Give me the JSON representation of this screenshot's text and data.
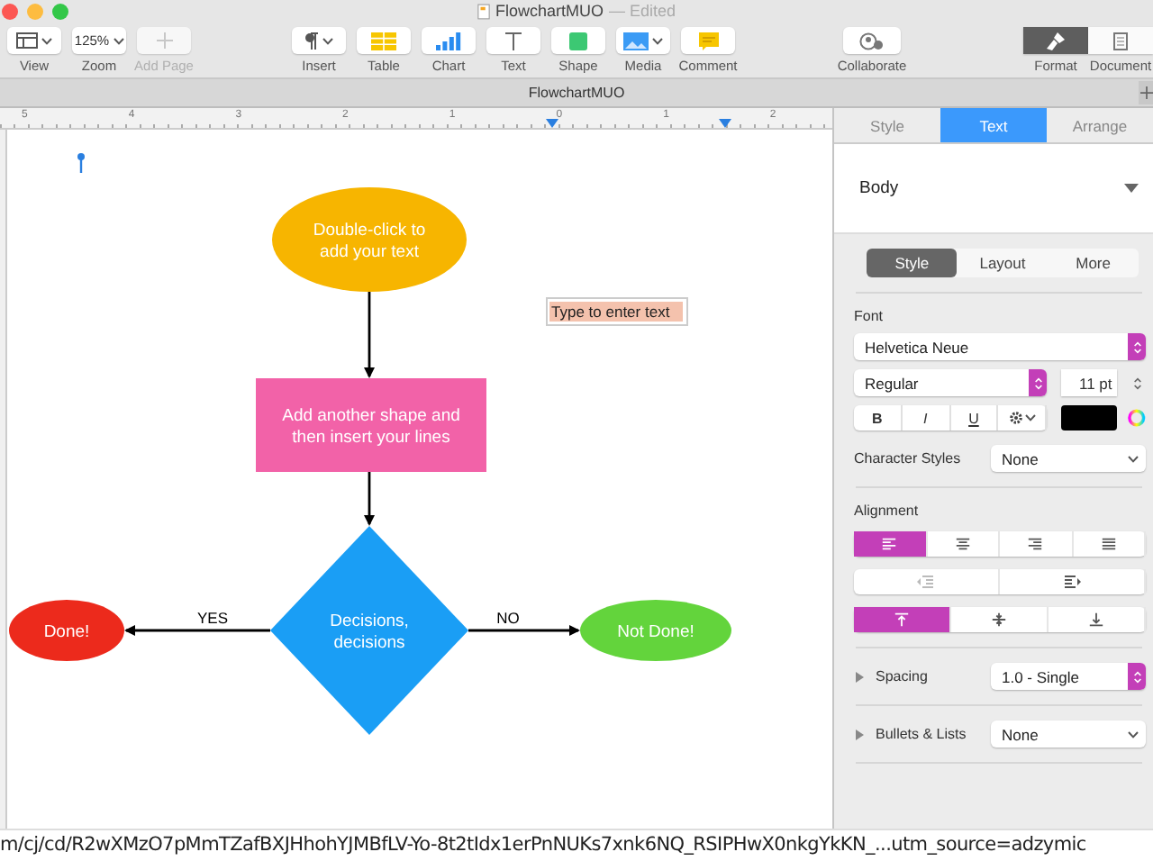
{
  "window": {
    "title": "FlowchartMUO",
    "status": "— Edited"
  },
  "toolbar_groups": [
    {
      "items": [
        {
          "label": "View",
          "kind": "popup",
          "disabled": false
        },
        {
          "label": "Zoom",
          "kind": "popup",
          "value": "125%",
          "disabled": false
        },
        {
          "label": "Add Page",
          "kind": "button",
          "disabled": true
        }
      ]
    },
    {
      "items": [
        {
          "label": "Insert",
          "kind": "popup",
          "disabled": false
        },
        {
          "label": "Table",
          "kind": "button",
          "disabled": false
        },
        {
          "label": "Chart",
          "kind": "button",
          "disabled": false
        },
        {
          "label": "Text",
          "kind": "button",
          "disabled": false
        },
        {
          "label": "Shape",
          "kind": "button",
          "disabled": false
        },
        {
          "label": "Media",
          "kind": "popup",
          "disabled": false
        },
        {
          "label": "Comment",
          "kind": "button",
          "disabled": false
        }
      ]
    },
    {
      "items": [
        {
          "label": "Collaborate",
          "kind": "button",
          "disabled": false
        }
      ]
    },
    {
      "items": [
        {
          "label": "Format",
          "kind": "button",
          "selected": true,
          "disabled": false
        },
        {
          "label": "Document",
          "kind": "button",
          "selected": false,
          "disabled": false
        }
      ]
    }
  ],
  "document_tab": {
    "title": "FlowchartMUO"
  },
  "ruler": {
    "labels": [
      "5",
      "4",
      "3",
      "2",
      "1",
      "0",
      "1",
      "2"
    ]
  },
  "canvas": {
    "nodes": [
      {
        "kind": "oval",
        "text": "Double-click to\nadd your text",
        "color": "#f7b500"
      },
      {
        "kind": "rect",
        "text": "Add another shape and\nthen insert your lines",
        "color": "#f262a8"
      },
      {
        "kind": "oval",
        "text": "Done!",
        "color": "#ec2a1c"
      },
      {
        "kind": "diamond",
        "text": "Decisions,\ndecisions",
        "color": "#1a9ef5"
      },
      {
        "kind": "oval",
        "text": "Not Done!",
        "color": "#63d43c"
      }
    ],
    "branches": [
      {
        "label": "YES"
      },
      {
        "label": "NO"
      }
    ],
    "text_box": {
      "placeholder": "Type to enter text"
    }
  },
  "inspector": {
    "tabs": [
      {
        "label": "Style",
        "selected": false
      },
      {
        "label": "Text",
        "selected": true
      },
      {
        "label": "Arrange",
        "selected": false
      }
    ],
    "paragraph_style": "Body",
    "segments": [
      {
        "label": "Style",
        "selected": true
      },
      {
        "label": "Layout",
        "selected": false
      },
      {
        "label": "More",
        "selected": false
      }
    ],
    "font_label": "Font",
    "font_family": "Helvetica Neue",
    "typeface": "Regular",
    "size": "11 pt",
    "text_buttons": [
      "B",
      "I",
      "U"
    ],
    "character_styles": {
      "label": "Character Styles",
      "value": "None"
    },
    "alignment_label": "Alignment",
    "horizontal_alignment": [
      {
        "selected": true
      },
      {
        "selected": false
      },
      {
        "selected": false
      },
      {
        "selected": false
      }
    ],
    "vertical_alignment": [
      {
        "selected": true
      },
      {
        "selected": false
      },
      {
        "selected": false
      }
    ],
    "spacing": {
      "label": "Spacing",
      "value": "1.0 - Single",
      "expanded": false
    },
    "bullets": {
      "label": "Bullets & Lists",
      "value": "None",
      "expanded": false
    }
  },
  "status_url": "m/cj/cd/R2wXMzO7pMmTZafBXJHhohYJMBfLV-Yo-8t2tIdx1erPnNUKs7xnk6NQ_RSIPHwX0nkgYkKN_...utm_source=adzymic"
}
